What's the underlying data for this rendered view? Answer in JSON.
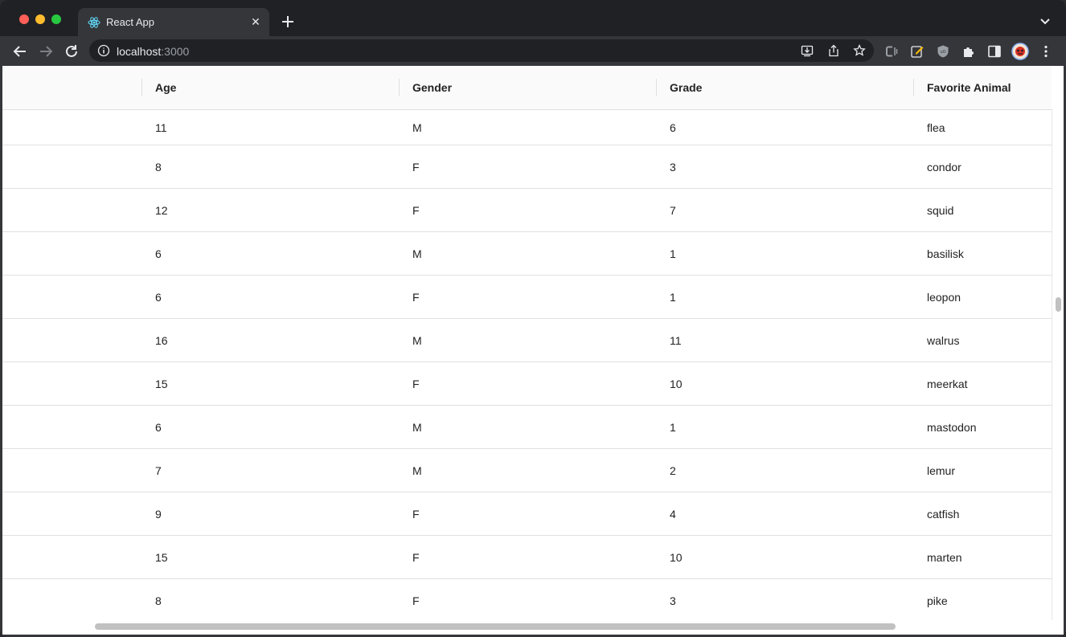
{
  "browser": {
    "tab_title": "React App",
    "url_host": "localhost",
    "url_port": ":3000",
    "colors": {
      "frame": "#202124",
      "toolbar": "#35363a"
    }
  },
  "table": {
    "columns": [
      "Age",
      "Gender",
      "Grade",
      "Favorite Animal"
    ],
    "rows": [
      [
        "11",
        "M",
        "6",
        "flea"
      ],
      [
        "8",
        "F",
        "3",
        "condor"
      ],
      [
        "12",
        "F",
        "7",
        "squid"
      ],
      [
        "6",
        "M",
        "1",
        "basilisk"
      ],
      [
        "6",
        "F",
        "1",
        "leopon"
      ],
      [
        "16",
        "M",
        "11",
        "walrus"
      ],
      [
        "15",
        "F",
        "10",
        "meerkat"
      ],
      [
        "6",
        "M",
        "1",
        "mastodon"
      ],
      [
        "7",
        "M",
        "2",
        "lemur"
      ],
      [
        "9",
        "F",
        "4",
        "catfish"
      ],
      [
        "15",
        "F",
        "10",
        "marten"
      ],
      [
        "8",
        "F",
        "3",
        "pike"
      ]
    ]
  }
}
